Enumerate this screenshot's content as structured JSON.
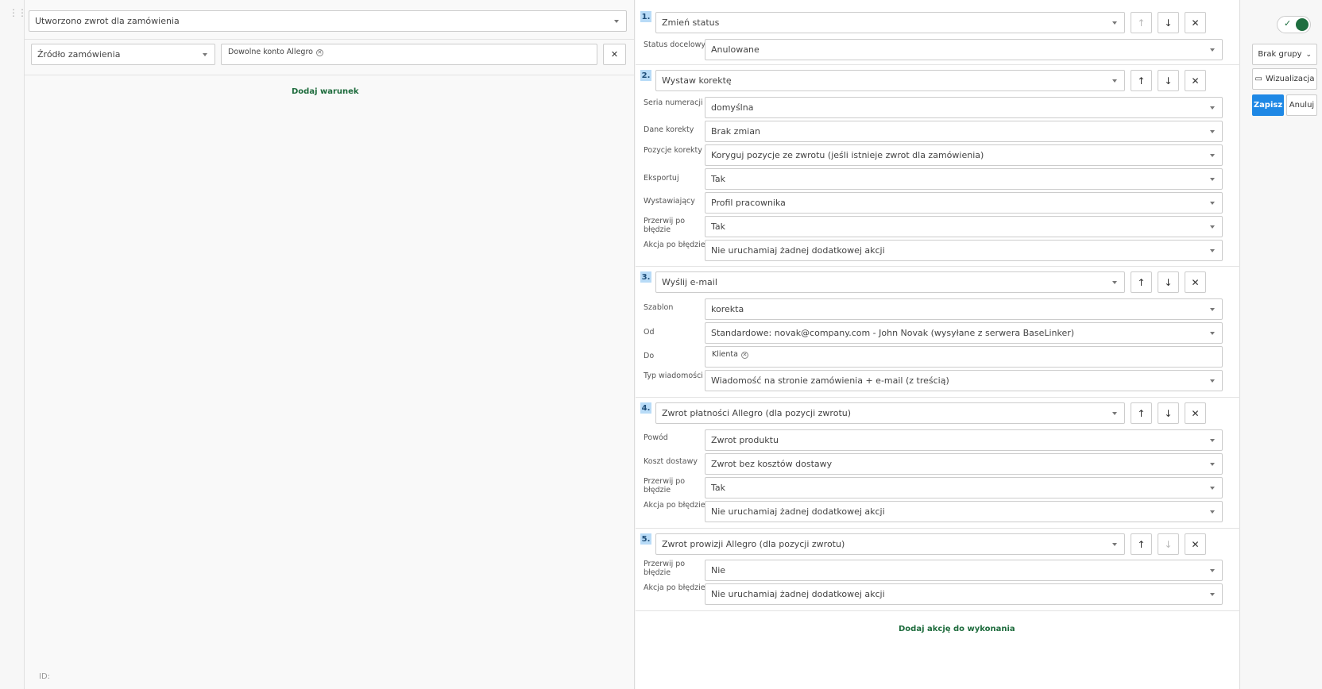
{
  "trigger": {
    "value": "Utworzono zwrot dla zamówienia"
  },
  "condition": {
    "source_select": "Źródło zamówienia",
    "tag": "Dowolne konto Allegro",
    "remove_btn": "✕"
  },
  "add_condition": "Dodaj warunek",
  "id_label": "ID:",
  "actions": [
    {
      "number": "1.",
      "name": "Zmień status",
      "fields": [
        {
          "label": "Status docelowy",
          "value": "Anulowane"
        }
      ]
    },
    {
      "number": "2.",
      "name": "Wystaw korektę",
      "fields": [
        {
          "label": "Seria numeracji",
          "value": "domyślna"
        },
        {
          "label": "Dane korekty",
          "value": "Brak zmian"
        },
        {
          "label": "Pozycje korekty",
          "value": "Koryguj pozycje ze zwrotu (jeśli istnieje zwrot dla zamówienia)"
        },
        {
          "label": "Eksportuj",
          "value": "Tak"
        },
        {
          "label": "Wystawiający",
          "value": "Profil pracownika"
        },
        {
          "label": "Przerwij po błędzie",
          "value": "Tak"
        },
        {
          "label": "Akcja po błędzie",
          "value": "Nie uruchamiaj żadnej dodatkowej akcji"
        }
      ]
    },
    {
      "number": "3.",
      "name": "Wyślij e-mail",
      "fields": [
        {
          "label": "Szablon",
          "value": "korekta"
        },
        {
          "label": "Od",
          "value": "Standardowe: novak@company.com - John Novak (wysyłane z serwera BaseLinker)"
        },
        {
          "label": "Do",
          "value": "Klienta"
        },
        {
          "label": "Typ wiadomości",
          "value": "Wiadomość na stronie zamówienia + e-mail (z treścią)"
        }
      ]
    },
    {
      "number": "4.",
      "name": "Zwrot płatności Allegro (dla pozycji zwrotu)",
      "fields": [
        {
          "label": "Powód",
          "value": "Zwrot produktu"
        },
        {
          "label": "Koszt dostawy",
          "value": "Zwrot bez kosztów dostawy"
        },
        {
          "label": "Przerwij po błędzie",
          "value": "Tak"
        },
        {
          "label": "Akcja po błędzie",
          "value": "Nie uruchamiaj żadnej dodatkowej akcji"
        }
      ]
    },
    {
      "number": "5.",
      "name": "Zwrot prowizji Allegro (dla pozycji zwrotu)",
      "fields": [
        {
          "label": "Przerwij po błędzie",
          "value": "Nie"
        },
        {
          "label": "Akcja po błędzie",
          "value": "Nie uruchamiaj żadnej dodatkowej akcji"
        }
      ]
    }
  ],
  "add_action": "Dodaj akcję do wykonania",
  "sidebar": {
    "group": "Brak grupy",
    "visualize": "Wizualizacja",
    "save": "Zapisz",
    "cancel": "Anuluj"
  },
  "icons": {
    "up": "arrow-up-icon",
    "down": "arrow-down-icon",
    "close": "close-icon",
    "monitor": "monitor-icon",
    "drag": "drag-handle-icon"
  },
  "colors": {
    "primary": "#1e88e5",
    "green": "#1d6b3c",
    "badge": "#b8dbf7"
  }
}
